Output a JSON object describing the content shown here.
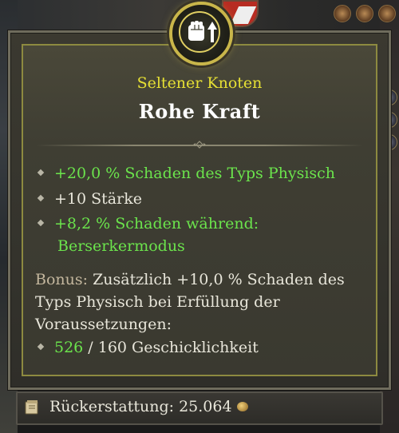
{
  "node": {
    "rarity": "Seltener Knoten",
    "name": "Rohe Kraft",
    "icon": "fist-up-arrow-icon"
  },
  "stats": [
    {
      "text": "+20,0 % Schaden des Typs Physisch",
      "color": "#6be44c"
    },
    {
      "text": "+10 Stärke",
      "color": "#e8e6da"
    },
    {
      "line1": "+8,2 % Schaden während:",
      "line2": "Berserkermodus",
      "color": "#6be44c"
    }
  ],
  "bonus": {
    "label": "Bonus:",
    "line1": " Zusätzlich +10,0 % Schaden des",
    "line2": "Typs Physisch bei Erfüllung der",
    "line3": "Voraussetzungen:"
  },
  "requirement": {
    "current": "526",
    "rest": " / 160 Geschicklichkeit"
  },
  "refund": {
    "label": "Rückerstattung: 25.064",
    "icon": "gold-coin-icon"
  },
  "colors": {
    "rarity": "#e6e034",
    "stat_green": "#6be44c",
    "panel_border": "#8d8a40"
  }
}
